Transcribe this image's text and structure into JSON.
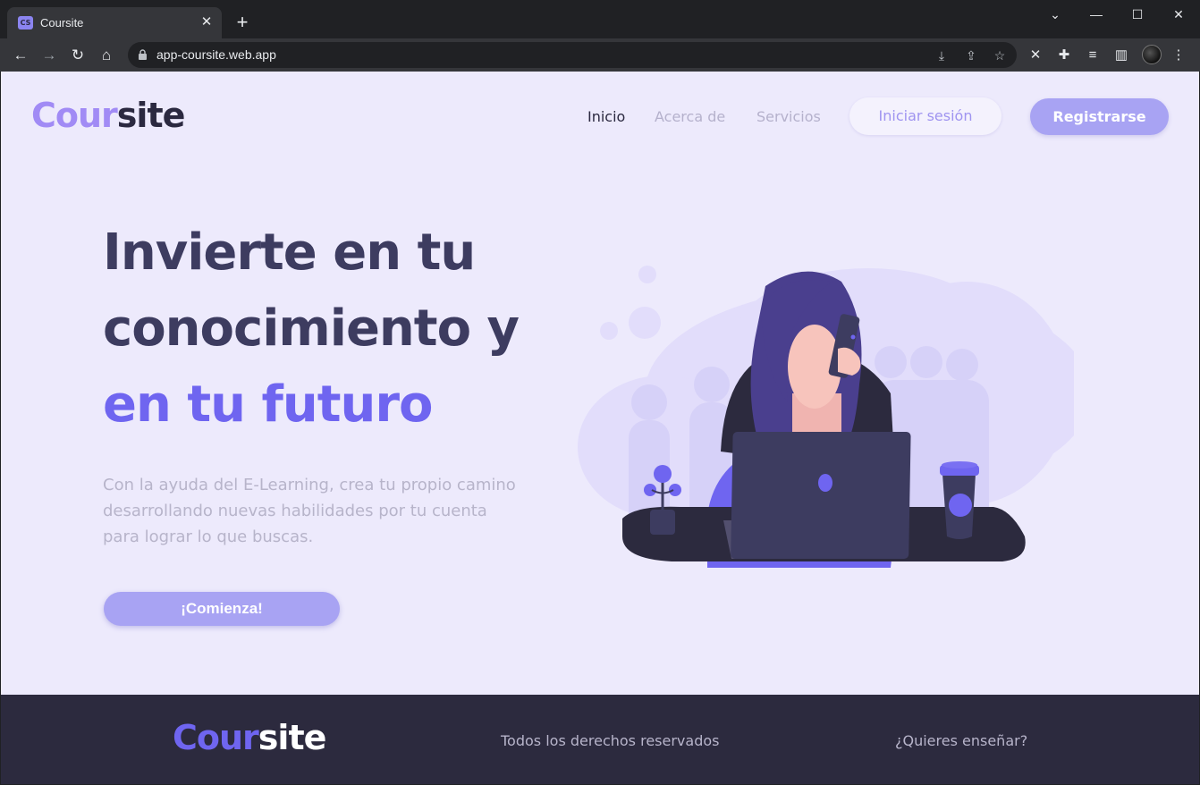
{
  "browser": {
    "tab_favicon": "CS",
    "tab_title": "Coursite",
    "url": "app-coursite.web.app"
  },
  "site": {
    "logo_part1": "Cour",
    "logo_part2": "site",
    "nav": [
      {
        "label": "Inicio",
        "active": true
      },
      {
        "label": "Acerca de",
        "active": false
      },
      {
        "label": "Servicios",
        "active": false
      }
    ],
    "login_label": "Iniciar sesión",
    "register_label": "Registrarse"
  },
  "hero": {
    "line1": "Invierte en tu",
    "line2": "conocimiento y",
    "line3": "en tu futuro",
    "lead_line1": "Con la ayuda del E-Learning, crea tu propio camino",
    "lead_line2": "desarrollando nuevas habilidades por tu cuenta",
    "lead_line3": "para lograr lo que buscas.",
    "cta_label": "¡Comienza!"
  },
  "footer": {
    "logo_part1": "Cour",
    "logo_part2": "site",
    "rights": "Todos los derechos reservados",
    "teach": "¿Quieres enseñar?"
  },
  "colors": {
    "page_bg": "#edeafc",
    "accent": "#6f65f0",
    "accent_light": "#a8a3f3",
    "dark": "#2c2a3e"
  }
}
